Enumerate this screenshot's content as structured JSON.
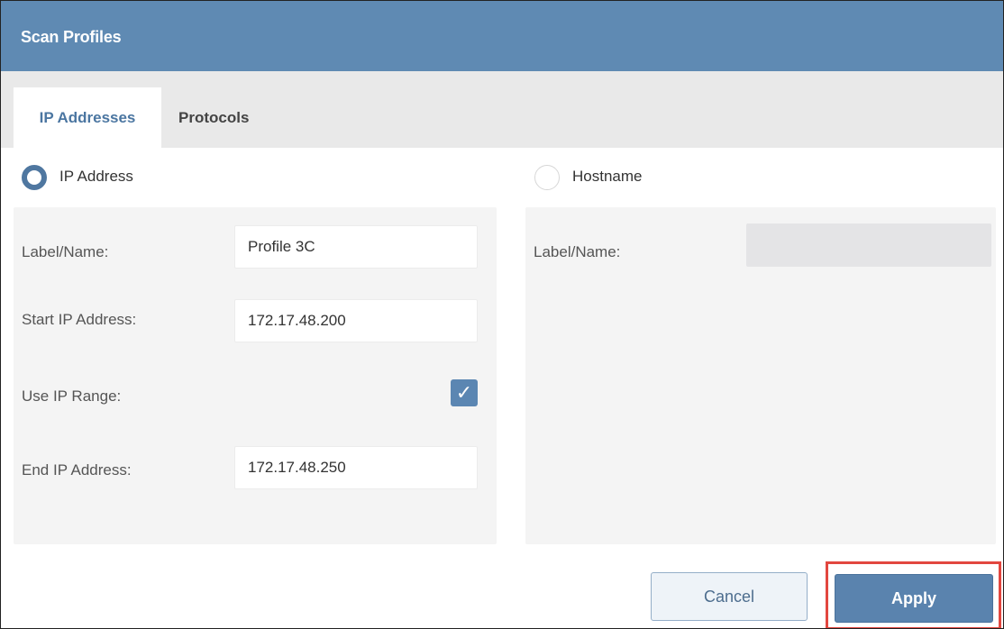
{
  "dialog": {
    "title": "Scan Profiles"
  },
  "tabs": [
    {
      "label": "IP Addresses",
      "active": true
    },
    {
      "label": "Protocols",
      "active": false
    }
  ],
  "mode_options": {
    "ip_address": {
      "label": "IP Address",
      "selected": true
    },
    "hostname": {
      "label": "Hostname",
      "selected": false
    }
  },
  "ip_panel": {
    "label_name": {
      "label": "Label/Name:",
      "value": "Profile 3C"
    },
    "start_ip": {
      "label": "Start IP Address:",
      "value": "172.17.48.200"
    },
    "use_range": {
      "label": "Use IP Range:",
      "checked": true
    },
    "end_ip": {
      "label": "End IP Address:",
      "value": "172.17.48.250"
    }
  },
  "hostname_panel": {
    "label_name": {
      "label": "Label/Name:",
      "value": ""
    }
  },
  "buttons": {
    "cancel": "Cancel",
    "apply": "Apply"
  },
  "colors": {
    "titlebar": "#5f8ab3",
    "accent": "#4f77a0",
    "highlight": "#e2473f"
  }
}
